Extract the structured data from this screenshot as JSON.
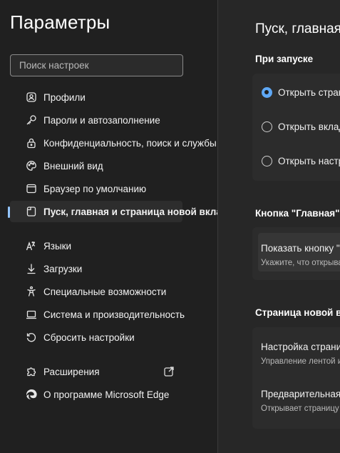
{
  "sidebar": {
    "title": "Параметры",
    "search_placeholder": "Поиск настроек",
    "items": [
      {
        "label": "Профили",
        "icon": "profile-icon"
      },
      {
        "label": "Пароли и автозаполнение",
        "icon": "key-icon"
      },
      {
        "label": "Конфиденциальность, поиск и службы",
        "icon": "lock-icon"
      },
      {
        "label": "Внешний вид",
        "icon": "palette-icon"
      },
      {
        "label": "Браузер по умолчанию",
        "icon": "browser-icon"
      },
      {
        "label": "Пуск, главная и страница новой вкладки",
        "icon": "start-page-icon",
        "active": true
      },
      {
        "label": "Языки",
        "icon": "languages-icon"
      },
      {
        "label": "Загрузки",
        "icon": "download-icon"
      },
      {
        "label": "Специальные возможности",
        "icon": "accessibility-icon"
      },
      {
        "label": "Система и производительность",
        "icon": "laptop-icon"
      },
      {
        "label": "Сбросить настройки",
        "icon": "reset-icon"
      },
      {
        "label": "Расширения",
        "icon": "puzzle-icon",
        "external": true
      },
      {
        "label": "О программе Microsoft Edge",
        "icon": "edge-icon"
      }
    ]
  },
  "main": {
    "page_title": "Пуск, главная и страница новой вкладки",
    "on_startup": {
      "title": "При запуске",
      "options": [
        {
          "label": "Открыть страницу новой вкладки",
          "checked": true
        },
        {
          "label": "Открыть вкладки из предыдущего сеанса",
          "checked": false
        },
        {
          "label": "Открыть настроенные страницы",
          "checked": false
        }
      ]
    },
    "home_button": {
      "title": "Кнопка \"Главная\"",
      "setting": "Показать кнопку \"Главная\" на панели инструментов",
      "description": "Укажите, что открывать при нажатии кнопки"
    },
    "new_tab": {
      "title": "Страница новой вкладки",
      "settings": [
        {
          "label": "Настройка страницы новой вкладки",
          "description": "Управление лентой и контентом"
        },
        {
          "label": "Предварительная загрузка страницы новой вкладки",
          "description": "Открывает страницу новой вкладки быстрее"
        }
      ]
    }
  },
  "colors": {
    "accent": "#5fa8f5",
    "active_indicator": "#93c5fd",
    "background": "#202020"
  }
}
